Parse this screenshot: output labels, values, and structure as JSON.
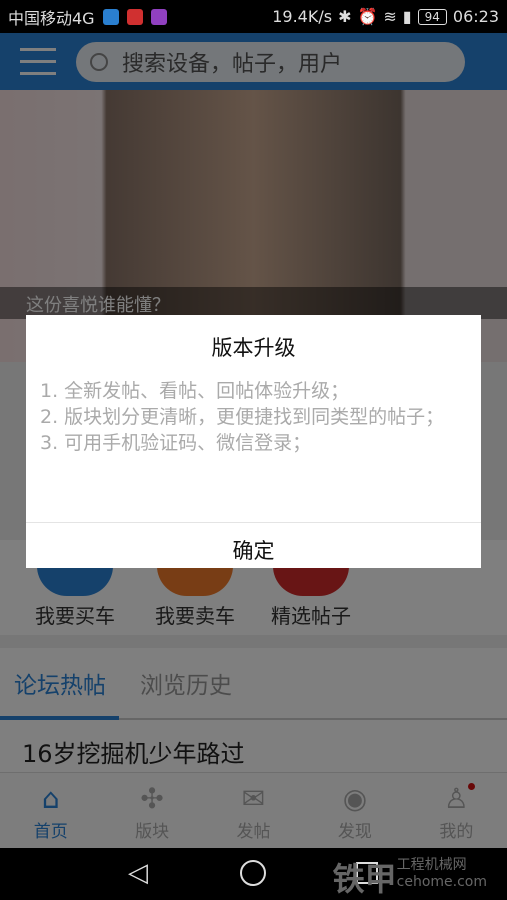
{
  "status": {
    "carrier": "中国移动4G",
    "speed": "19.4K/s",
    "battery": "94",
    "time": "06:23"
  },
  "header": {
    "search_placeholder": "搜索设备，帖子，用户"
  },
  "banner": {
    "caption": "这份喜悦谁能懂？"
  },
  "quick": [
    {
      "label": "我要买车",
      "color": "#2b83d6"
    },
    {
      "label": "我要卖车",
      "color": "#f07a2a"
    },
    {
      "label": "精选帖子",
      "color": "#d02a2a"
    }
  ],
  "tabs": [
    {
      "label": "论坛热帖",
      "active": true
    },
    {
      "label": "浏览历史",
      "active": false
    }
  ],
  "posts": [
    {
      "title": "16岁挖掘机少年路过"
    }
  ],
  "nav": [
    {
      "label": "首页",
      "icon": "home-icon",
      "active": true
    },
    {
      "label": "版块",
      "icon": "puzzle-icon"
    },
    {
      "label": "发帖",
      "icon": "send-post-icon"
    },
    {
      "label": "发现",
      "icon": "eye-icon"
    },
    {
      "label": "我的",
      "icon": "user-icon",
      "badge": true
    }
  ],
  "dialog": {
    "title": "版本升级",
    "lines": [
      "1. 全新发帖、看帖、回帖体验升级；",
      "2. 版块划分更清晰，更便捷找到同类型的帖子；",
      "3. 可用手机验证码、微信登录；"
    ],
    "confirm": "确定"
  },
  "watermark": {
    "brand": "铁甲",
    "tag": "工程机械网",
    "domain": "cehome.com"
  },
  "colors": {
    "accent": "#2b83d6"
  }
}
